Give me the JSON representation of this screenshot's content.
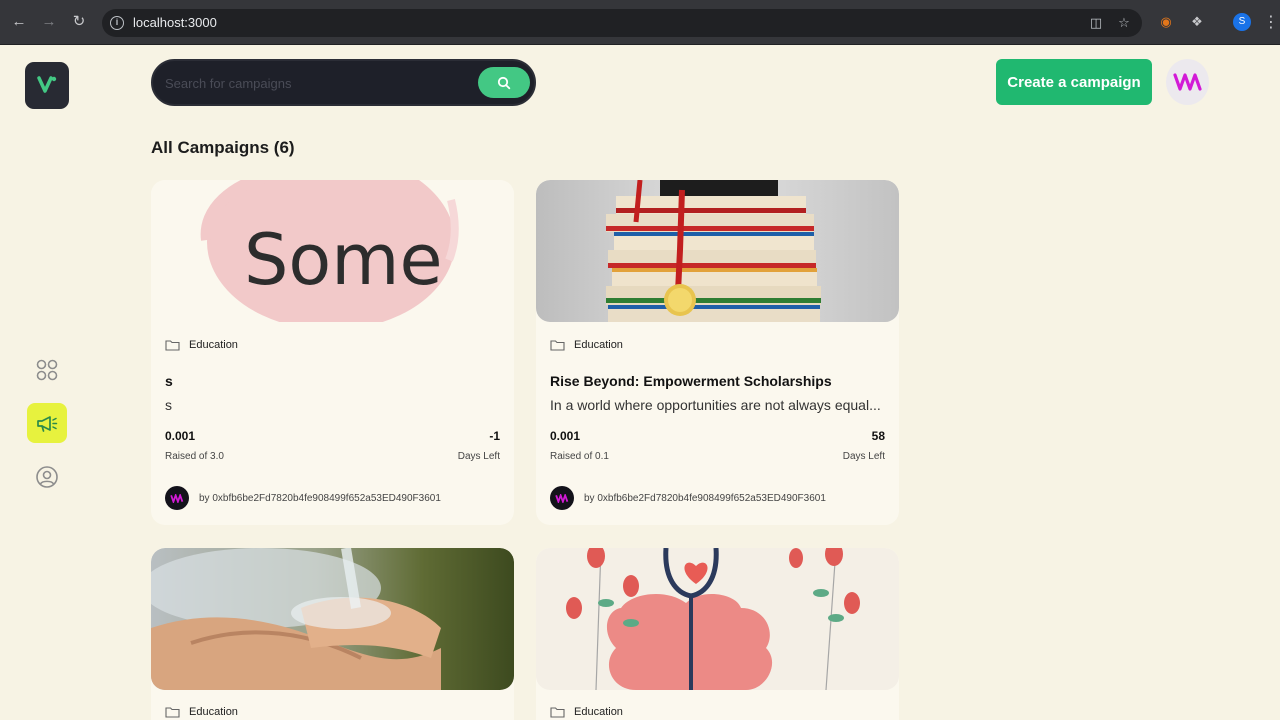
{
  "browser": {
    "url": "localhost:3000",
    "profile_initial": "S"
  },
  "search": {
    "placeholder": "Search for campaigns"
  },
  "header": {
    "create_label": "Create a campaign"
  },
  "section_title": "All Campaigns (6)",
  "accent_colors": {
    "brand_green": "#20b870",
    "active_nav": "#e7f23e",
    "bg": "#f7f3e4"
  },
  "campaigns": [
    {
      "thumb_text": "Some",
      "category": "Education",
      "title": "s",
      "description": "s",
      "raised": "0.001",
      "raised_label": "Raised of 3.0",
      "days": "-1",
      "days_label": "Days Left",
      "owner": "by 0xbfb6be2Fd7820b4fe908499f652a53ED490F3601"
    },
    {
      "category": "Education",
      "title": "Rise Beyond: Empowerment Scholarships",
      "description": "In a world where opportunities are not always equal...",
      "raised": "0.001",
      "raised_label": "Raised of 0.1",
      "days": "58",
      "days_label": "Days Left",
      "owner": "by 0xbfb6be2Fd7820b4fe908499f652a53ED490F3601"
    },
    {
      "category": "Education"
    },
    {
      "category": "Education"
    }
  ]
}
